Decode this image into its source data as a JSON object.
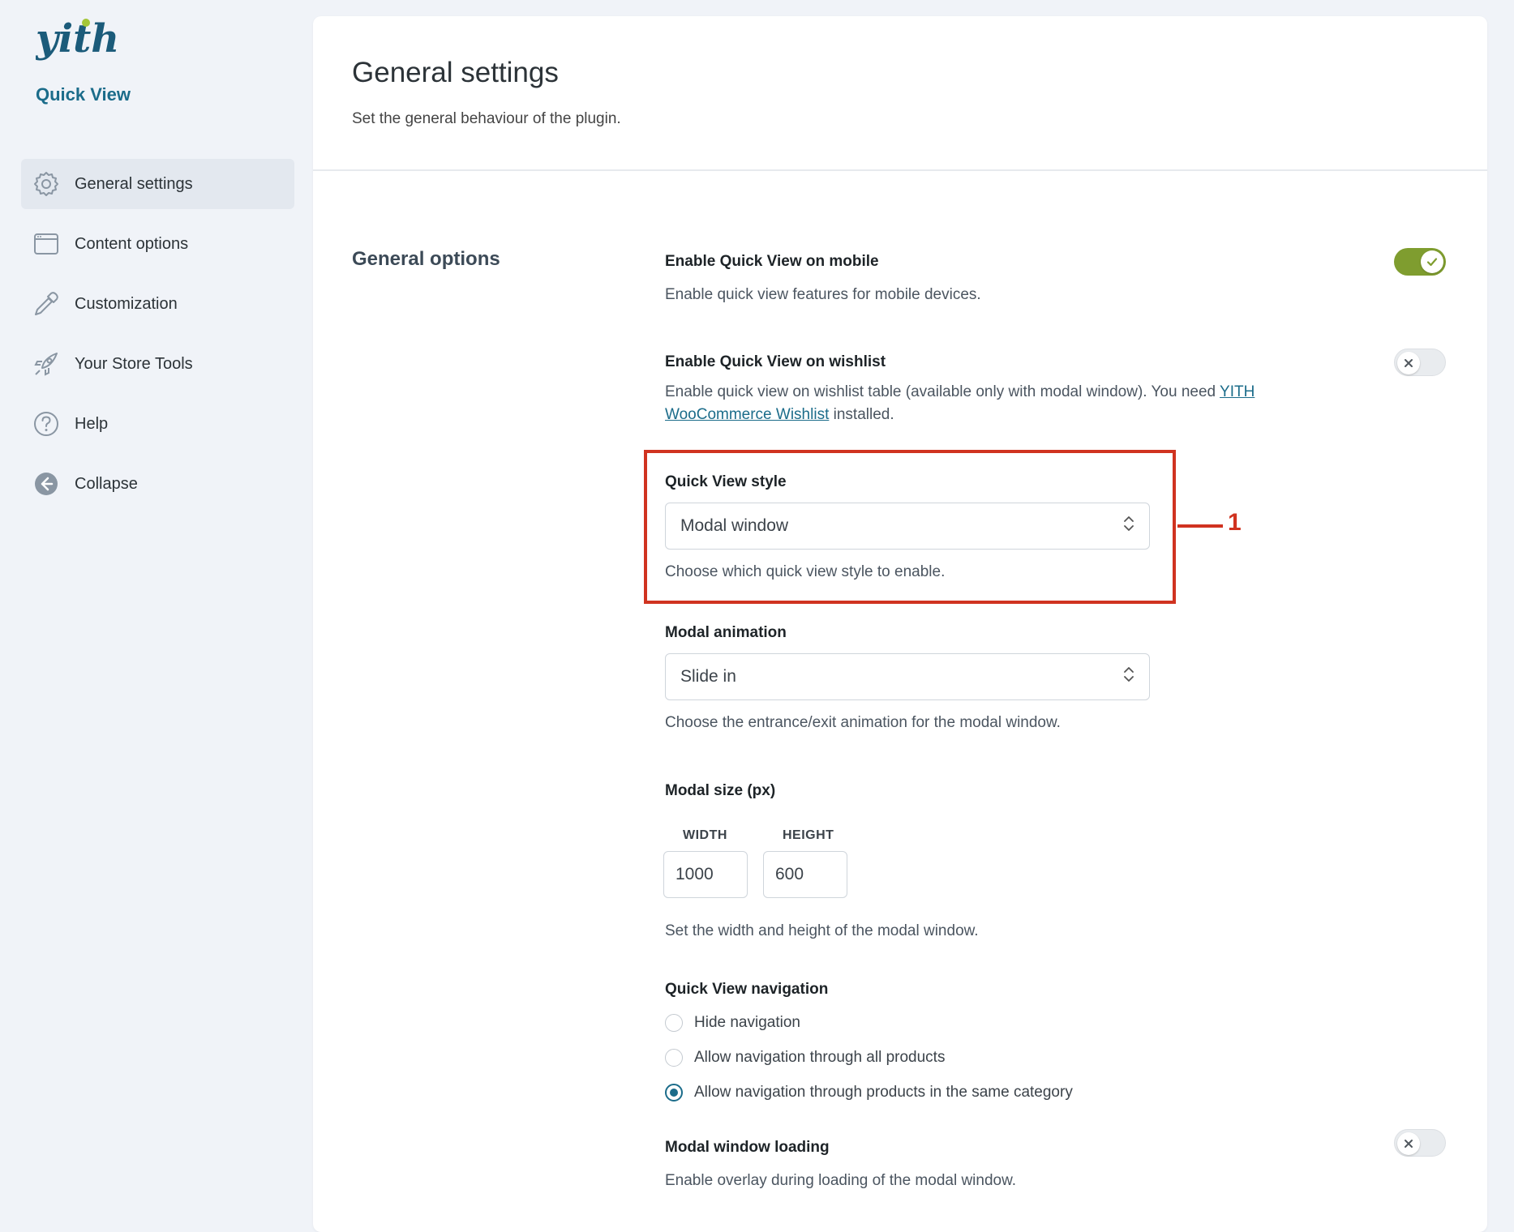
{
  "app": {
    "logo_text": "yith",
    "subtitle": "Quick View"
  },
  "sidebar": {
    "items": [
      {
        "label": "General settings",
        "icon": "gear-icon",
        "active": true
      },
      {
        "label": "Content options",
        "icon": "window-icon",
        "active": false
      },
      {
        "label": "Customization",
        "icon": "pipette-icon",
        "active": false
      },
      {
        "label": "Your Store Tools",
        "icon": "rocket-icon",
        "active": false
      },
      {
        "label": "Help",
        "icon": "question-circle-icon",
        "active": false
      },
      {
        "label": "Collapse",
        "icon": "arrow-left-circle-icon",
        "active": false
      }
    ]
  },
  "page": {
    "title": "General settings",
    "description": "Set the general behaviour of the plugin.",
    "section_title": "General options"
  },
  "options": {
    "mobile": {
      "label": "Enable Quick View on mobile",
      "desc": "Enable quick view features for mobile devices.",
      "enabled": true
    },
    "wishlist": {
      "label": "Enable Quick View on wishlist",
      "desc_before": "Enable quick view on wishlist table (available only with modal window). You need ",
      "link": "YITH WooCommerce Wishlist",
      "desc_after": " installed.",
      "enabled": false
    },
    "style": {
      "label": "Quick View style",
      "value": "Modal window",
      "desc": "Choose which quick view style to enable."
    },
    "animation": {
      "label": "Modal animation",
      "value": "Slide in",
      "desc": "Choose the entrance/exit animation for the modal window."
    },
    "size": {
      "label": "Modal size (px)",
      "width_label": "WIDTH",
      "height_label": "HEIGHT",
      "width": "1000",
      "height": "600",
      "desc": "Set the width and height of the modal window."
    },
    "navigation": {
      "label": "Quick View navigation",
      "choices": [
        {
          "label": "Hide navigation",
          "checked": false
        },
        {
          "label": "Allow navigation through all products",
          "checked": false
        },
        {
          "label": "Allow navigation through products in the same category",
          "checked": true
        }
      ]
    },
    "loading": {
      "label": "Modal window loading",
      "desc": "Enable overlay during loading of the modal window.",
      "enabled": false
    }
  },
  "annotation": {
    "number": "1"
  },
  "colors": {
    "accent": "#1b6c8a",
    "toggle_on": "#7f9d2f",
    "highlight": "#d03320",
    "logo_dot": "#a4c639"
  }
}
